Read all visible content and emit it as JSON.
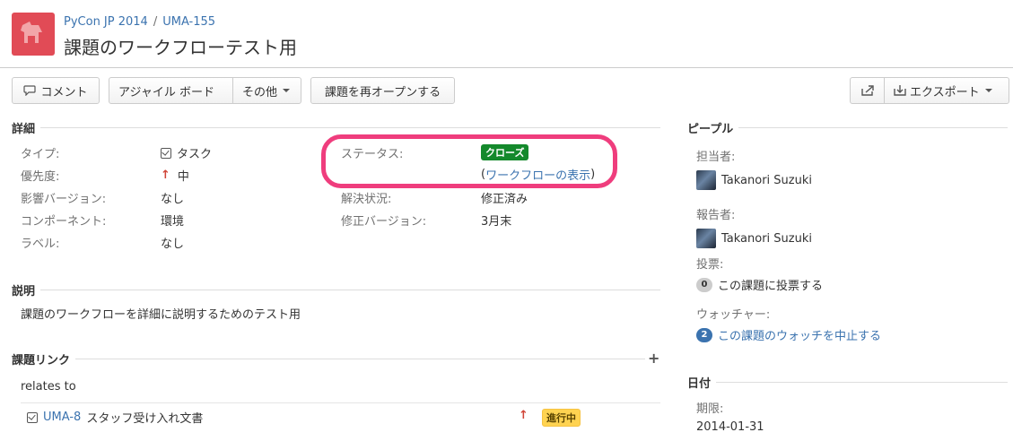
{
  "breadcrumbs": {
    "project": "PyCon JP 2014",
    "separator": "/",
    "issue_key": "UMA-155"
  },
  "summary": "課題のワークフローテスト用",
  "toolbar": {
    "comment": "コメント",
    "agile_board": "アジャイル ボード",
    "more": "その他",
    "reopen": "課題を再オープンする",
    "export": "エクスポート"
  },
  "details": {
    "heading": "詳細",
    "type_label": "タイプ:",
    "type_value": "タスク",
    "priority_label": "優先度:",
    "priority_value": "中",
    "affects_label": "影響バージョン:",
    "affects_value": "なし",
    "component_label": "コンポーネント:",
    "component_value": "環境",
    "labels_label": "ラベル:",
    "labels_value": "なし",
    "status_label": "ステータス:",
    "status_value": "クローズ",
    "workflow_open": "(",
    "workflow_link": "ワークフローの表示",
    "workflow_close": ")",
    "resolution_label": "解決状況:",
    "resolution_value": "修正済み",
    "fix_label": "修正バージョン:",
    "fix_value": "3月末"
  },
  "description": {
    "heading": "説明",
    "text": "課題のワークフローを詳細に説明するためのテスト用"
  },
  "links": {
    "heading": "課題リンク",
    "add": "+",
    "relation": "relates to",
    "items": [
      {
        "key": "UMA-8",
        "summary": "スタッフ受け入れ文書",
        "status": "進行中"
      }
    ]
  },
  "people": {
    "heading": "ピープル",
    "assignee_label": "担当者:",
    "assignee": "Takanori Suzuki",
    "reporter_label": "報告者:",
    "reporter": "Takanori Suzuki",
    "votes_label": "投票:",
    "votes_count": "0",
    "votes_link": "この課題に投票する",
    "watchers_label": "ウォッチャー:",
    "watchers_count": "2",
    "watchers_link": "この課題のウォッチを中止する"
  },
  "dates": {
    "heading": "日付",
    "due_label": "期限:",
    "due_value": "2014-01-31"
  },
  "colors": {
    "link": "#3b73af",
    "closed": "#14892c",
    "in_progress": "#ffd351",
    "highlight": "#ef3d7d",
    "project_avatar": "#e14b56"
  }
}
